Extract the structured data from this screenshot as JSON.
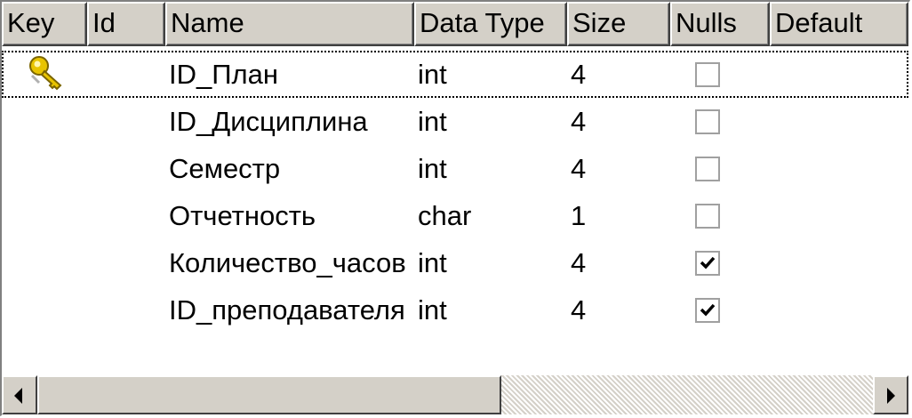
{
  "columns": {
    "key": "Key",
    "id": "Id",
    "name": "Name",
    "data_type": "Data Type",
    "size": "Size",
    "nulls": "Nulls",
    "default": "Default"
  },
  "rows": [
    {
      "primary_key": true,
      "id": "",
      "name": "ID_План",
      "data_type": "int",
      "size": "4",
      "nulls": false,
      "default": ""
    },
    {
      "primary_key": false,
      "id": "",
      "name": "ID_Дисциплина",
      "data_type": "int",
      "size": "4",
      "nulls": false,
      "default": ""
    },
    {
      "primary_key": false,
      "id": "",
      "name": "Семестр",
      "data_type": "int",
      "size": "4",
      "nulls": false,
      "default": ""
    },
    {
      "primary_key": false,
      "id": "",
      "name": "Отчетность",
      "data_type": "char",
      "size": "1",
      "nulls": false,
      "default": ""
    },
    {
      "primary_key": false,
      "id": "",
      "name": "Количество_часов",
      "data_type": "int",
      "size": "4",
      "nulls": true,
      "default": ""
    },
    {
      "primary_key": false,
      "id": "",
      "name": "ID_преподавателя",
      "data_type": "int",
      "size": "4",
      "nulls": true,
      "default": ""
    }
  ],
  "icons": {
    "primary_key": "key-icon",
    "scroll_left": "arrow-left-icon",
    "scroll_right": "arrow-right-icon"
  },
  "colors": {
    "chrome": "#d4d0c8",
    "key_gold": "#e8c400"
  },
  "scrollbar": {
    "position": 0.0
  }
}
